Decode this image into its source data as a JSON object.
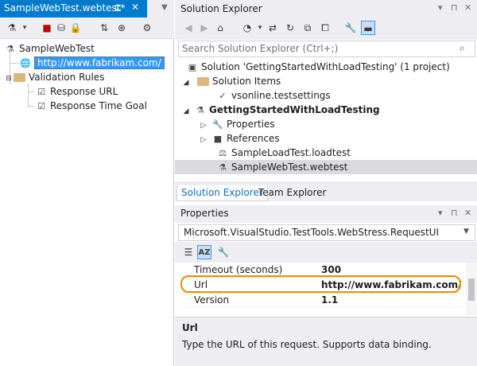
{
  "editor": {
    "tab_title": "SampleWebTest.webtest*",
    "pin_glyph": "⊑",
    "close_glyph": "✕",
    "tree": {
      "root": "SampleWebTest",
      "request_url": "http://www.fabrikam.com/",
      "validation_rules": "Validation Rules",
      "rules": [
        "Response URL",
        "Response Time Goal"
      ]
    }
  },
  "solution_explorer": {
    "title": "Solution Explorer",
    "search_placeholder": "Search Solution Explorer (Ctrl+;)",
    "tree": {
      "solution": "Solution 'GettingStartedWithLoadTesting' (1 project)",
      "solution_items": "Solution Items",
      "testsettings": "vsonline.testsettings",
      "project": "GettingStartedWithLoadTesting",
      "properties": "Properties",
      "references": "References",
      "loadtest": "SampleLoadTest.loadtest",
      "webtest": "SampleWebTest.webtest"
    },
    "tabs": [
      "Solution Explorer",
      "Team Explorer"
    ]
  },
  "properties": {
    "title": "Properties",
    "object": "Microsoft.VisualStudio.TestTools.WebStress.RequestUI",
    "rows": [
      {
        "name": "Timeout (seconds)",
        "value": "300"
      },
      {
        "name": "Url",
        "value": "http://www.fabrikam.com/"
      },
      {
        "name": "Version",
        "value": "1.1"
      }
    ],
    "description_title": "Url",
    "description_text": "Type the URL of this request. Supports data binding."
  },
  "colors": {
    "accent": "#007acc",
    "selection": "#3399ff",
    "highlight_ring": "#f08c00"
  }
}
